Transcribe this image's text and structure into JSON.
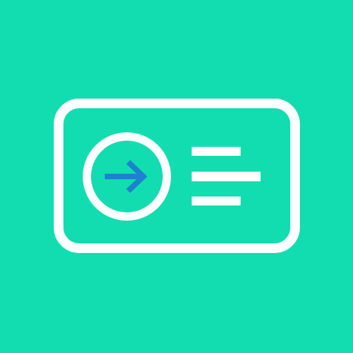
{
  "icon": {
    "name": "card-with-arrow-and-lines",
    "colors": {
      "background": "#12DDB0",
      "stroke": "#FFFFFF",
      "arrow": "#1C82CC"
    },
    "parts": {
      "card": "card-outline",
      "circle": "circle-outline",
      "arrow": "arrow-right-icon",
      "lines": [
        "text-line",
        "text-line",
        "text-line"
      ]
    }
  }
}
